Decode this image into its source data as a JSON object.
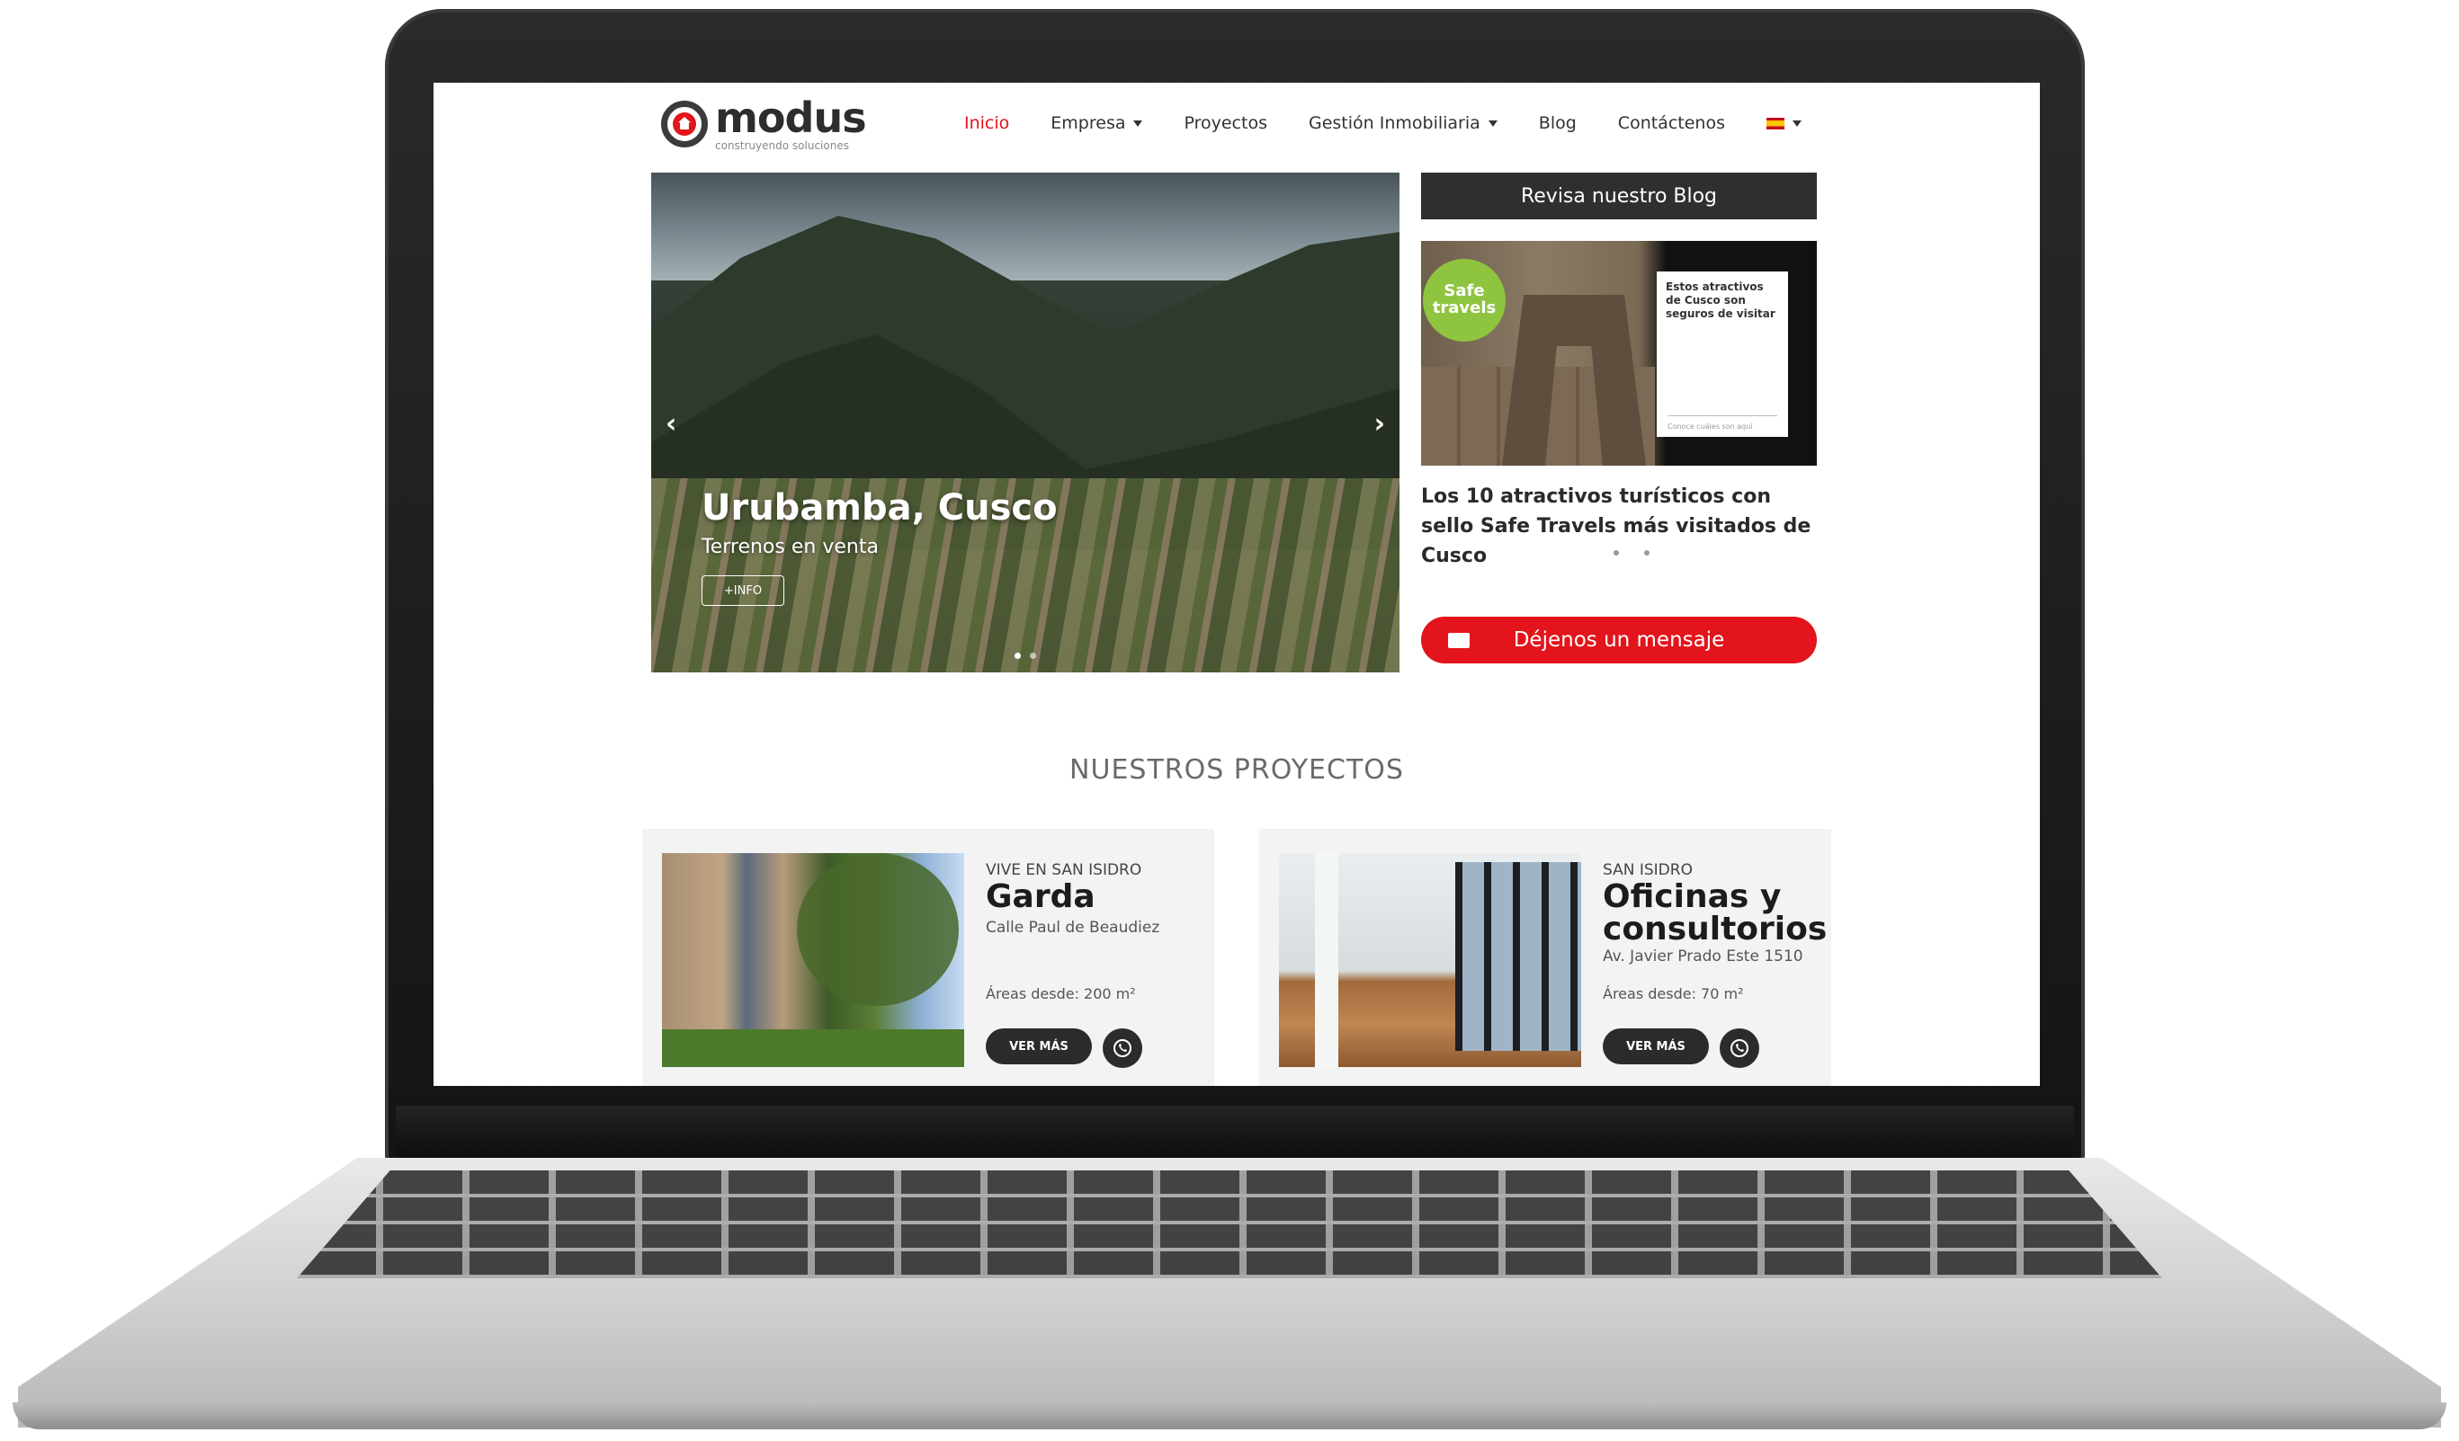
{
  "brand": {
    "name": "modus",
    "tagline": "construyendo soluciones",
    "accent": "#e3141b",
    "dark": "#2b2b2b"
  },
  "nav": {
    "items": [
      {
        "label": "Inicio",
        "active": true,
        "dropdown": false
      },
      {
        "label": "Empresa",
        "active": false,
        "dropdown": true
      },
      {
        "label": "Proyectos",
        "active": false,
        "dropdown": false
      },
      {
        "label": "Gestión Inmobiliaria",
        "active": false,
        "dropdown": true
      },
      {
        "label": "Blog",
        "active": false,
        "dropdown": false
      },
      {
        "label": "Contáctenos",
        "active": false,
        "dropdown": false
      }
    ],
    "language_icon": "spain-flag-icon"
  },
  "hero": {
    "title": "Urubamba, Cusco",
    "subtitle": "Terrenos en venta",
    "button": "+INFO",
    "prev_icon": "chevron-left-icon",
    "next_icon": "chevron-right-icon"
  },
  "blog": {
    "header": "Revisa nuestro Blog",
    "badge_line1": "Safe",
    "badge_line2": "travels",
    "card_text": "Estos atractivos de Cusco son seguros de visitar",
    "card_footer": "Conoce cuáles son aquí",
    "caption": "Los 10 atractivos turísticos con sello Safe Travels más visitados de Cusco"
  },
  "message_button": {
    "label": "Déjenos un mensaje",
    "icon": "envelope-icon"
  },
  "projects": {
    "section_title": "NUESTROS PROYECTOS",
    "cards": [
      {
        "label": "VIVE EN SAN ISIDRO",
        "name": "Garda",
        "address": "Calle Paul de Beaudiez",
        "area": "Áreas desde: 200 m²",
        "button": "VER MÁS",
        "icon": "whatsapp-icon"
      },
      {
        "label": "SAN ISIDRO",
        "name": "Oficinas y consultorios",
        "address": "Av. Javier Prado Este 1510",
        "area": "Áreas desde: 70 m²",
        "button": "VER MÁS",
        "icon": "whatsapp-icon"
      }
    ]
  }
}
